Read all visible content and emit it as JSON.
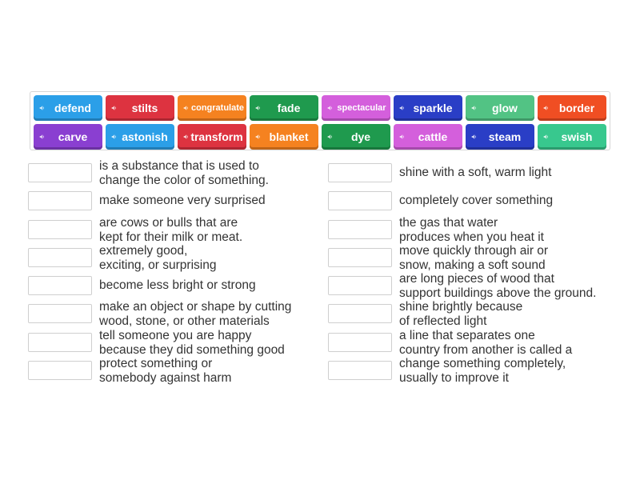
{
  "colors": {
    "blue": "#2b9fe8",
    "red": "#dd3340",
    "orange": "#f58220",
    "green": "#1f9a4e",
    "pink": "#d45fdc",
    "navy": "#2a3ec6",
    "lime": "#52c384",
    "orangered": "#f04e23",
    "purple": "#8a3fd1",
    "teal": "#38c88e"
  },
  "speaker_icon": "speaker-icon",
  "tiles": [
    {
      "word": "defend",
      "color": "#2b9fe8"
    },
    {
      "word": "stilts",
      "color": "#dd3340"
    },
    {
      "word": "congratulate",
      "color": "#f58220"
    },
    {
      "word": "fade",
      "color": "#1f9a4e"
    },
    {
      "word": "spectacular",
      "color": "#d45fdc"
    },
    {
      "word": "sparkle",
      "color": "#2a3ec6"
    },
    {
      "word": "glow",
      "color": "#52c384"
    },
    {
      "word": "border",
      "color": "#f04e23"
    },
    {
      "word": "carve",
      "color": "#8a3fd1"
    },
    {
      "word": "astonish",
      "color": "#2b9fe8"
    },
    {
      "word": "transform",
      "color": "#dd3340"
    },
    {
      "word": "blanket",
      "color": "#f58220"
    },
    {
      "word": "dye",
      "color": "#1f9a4e"
    },
    {
      "word": "cattle",
      "color": "#d45fdc"
    },
    {
      "word": "steam",
      "color": "#2a3ec6"
    },
    {
      "word": "swish",
      "color": "#38c88e"
    }
  ],
  "left_clues": [
    "is a substance that is used to\nchange the color of something.",
    "make someone very surprised",
    "are cows or bulls that are\nkept for their milk or meat.",
    "extremely good,\nexciting, or surprising",
    "become less bright or strong",
    "make an object or shape by cutting\nwood, stone, or other materials",
    "tell someone you are happy\nbecause they did something good",
    "protect something or\nsomebody against harm"
  ],
  "right_clues": [
    "shine with a soft, warm light",
    "completely cover something",
    "the gas that water\nproduces when you heat it",
    "move quickly through air or\nsnow, making a soft sound",
    "are long pieces of wood that\nsupport buildings above the ground.",
    "shine brightly because\nof reflected light",
    "a line that separates one\ncountry from another is called a",
    "change something completely,\nusually to improve it"
  ]
}
